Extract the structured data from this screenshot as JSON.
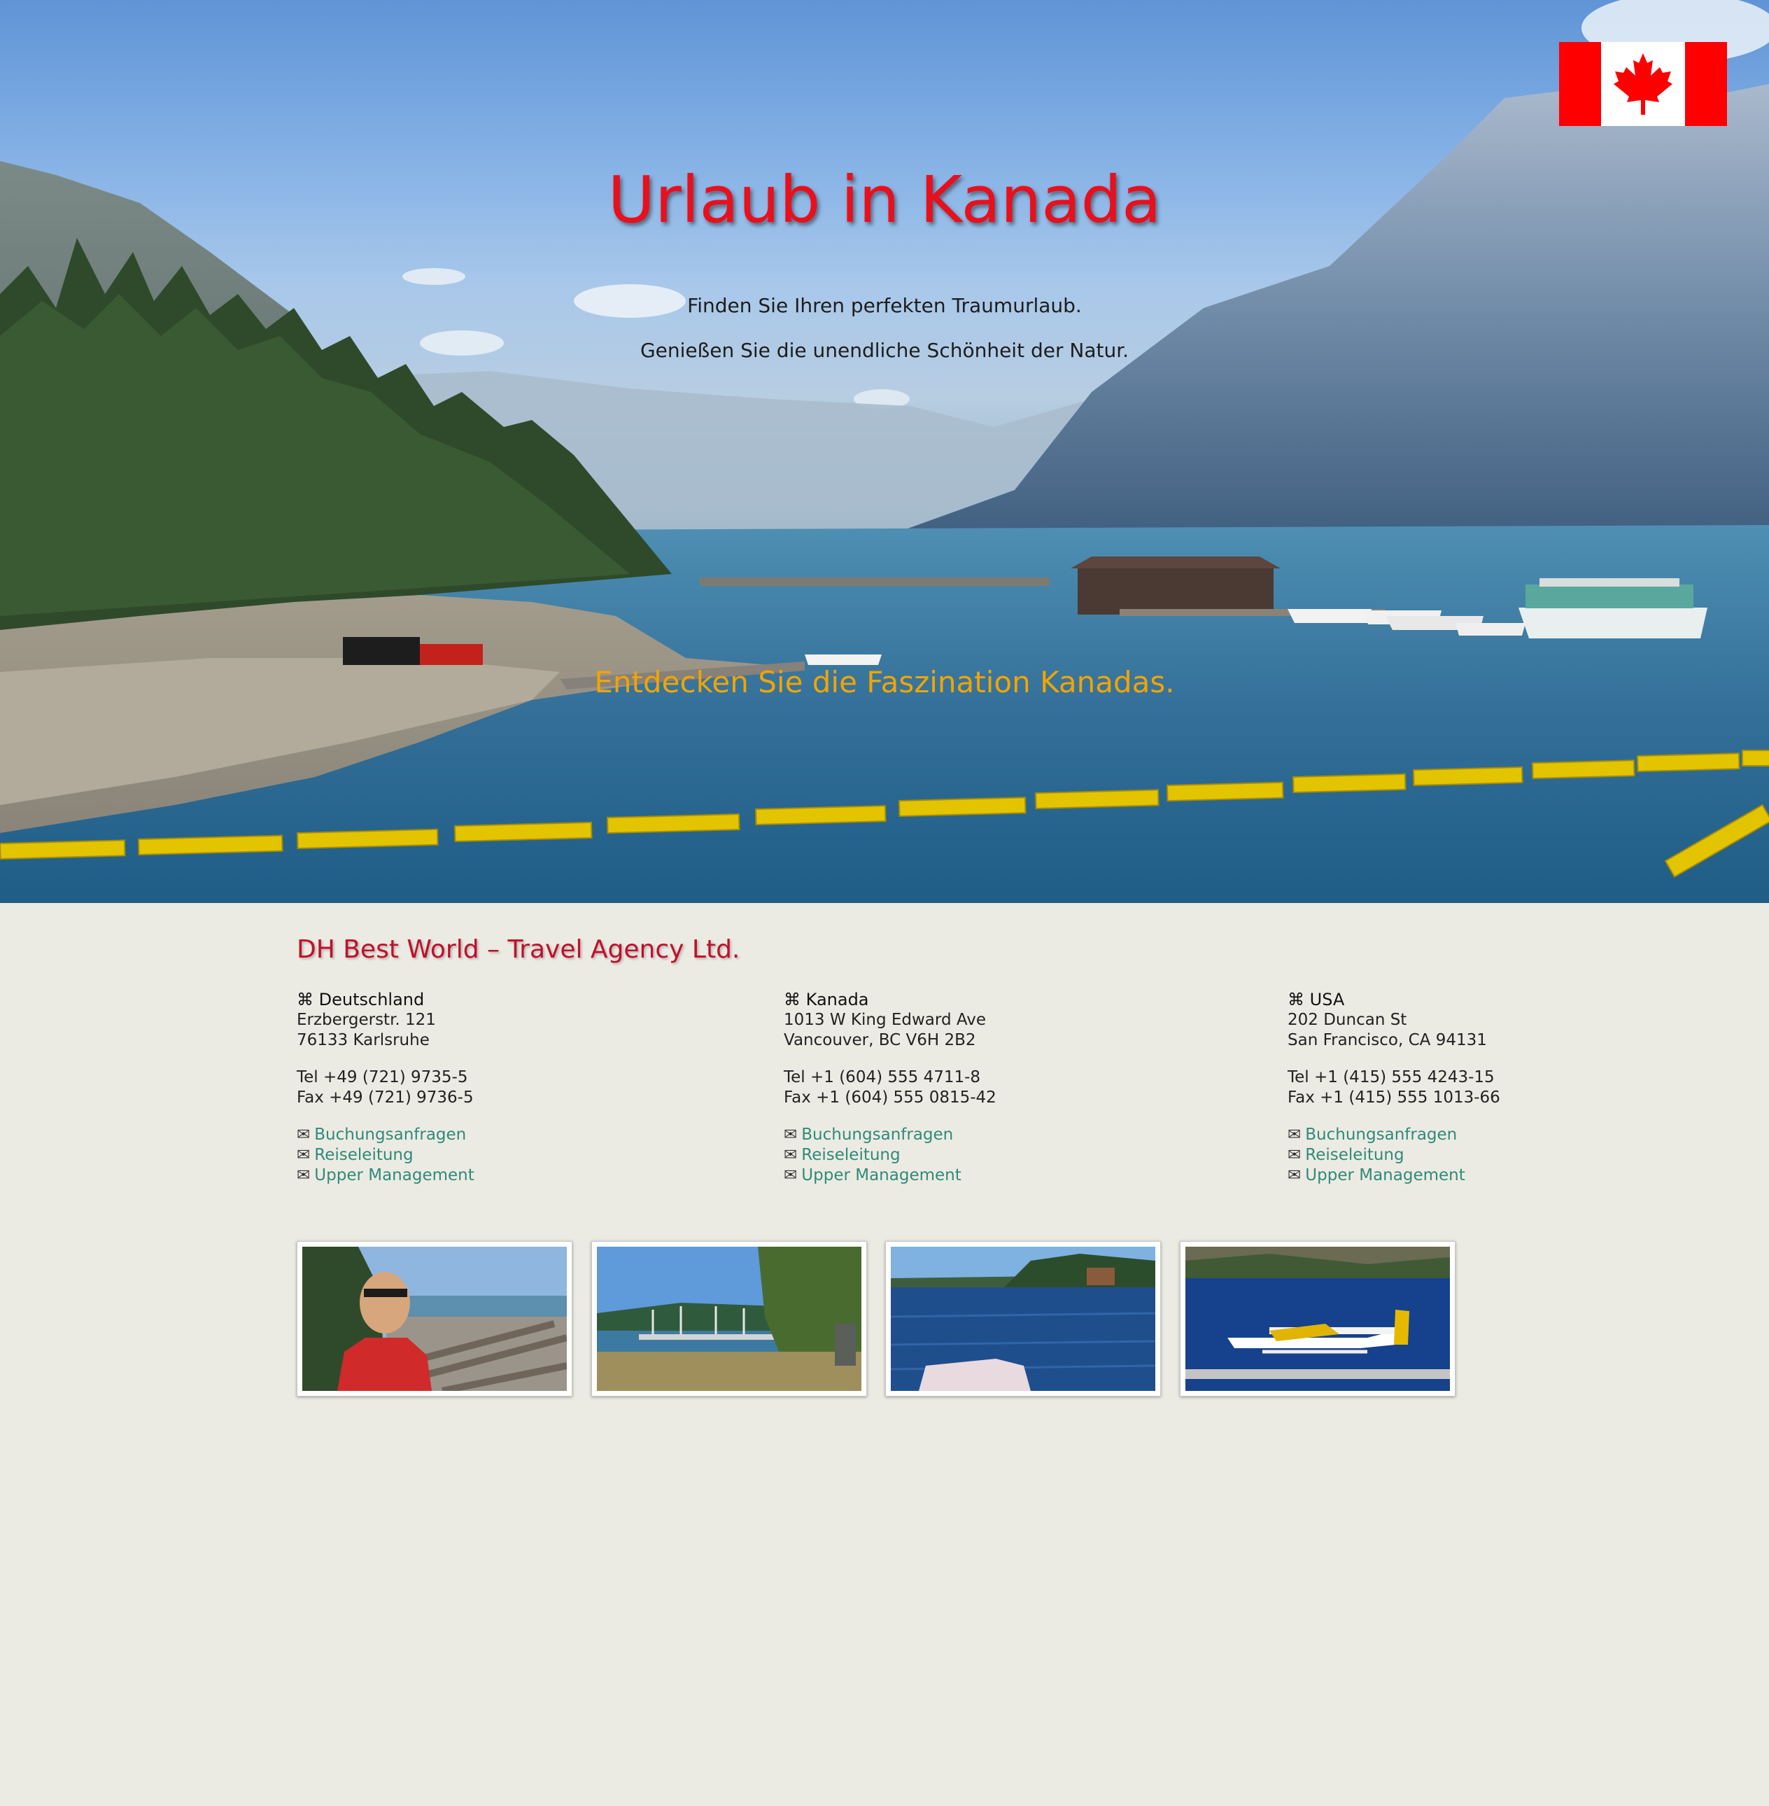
{
  "hero": {
    "title": "Urlaub in Kanada",
    "subtitle_1": "Finden Sie Ihren perfekten Traumurlaub.",
    "subtitle_2": "Genießen Sie die unendliche Schönheit der Natur.",
    "tagline": "Entdecken Sie die Faszination Kanadas.",
    "flag_icon": "canada-flag-icon",
    "colors": {
      "title": "#e8101c",
      "tagline": "#f2a400",
      "flag_red": "#ff0000"
    }
  },
  "company": {
    "name": "DH Best World – Travel Agency Ltd.",
    "color": "#c0102c"
  },
  "offices": [
    {
      "country": "⌘ Deutschland",
      "street": "Erzbergerstr. 121",
      "city": "76133 Karlsruhe",
      "tel": "Tel +49 (721) 9735-5",
      "fax": "Fax +49 (721) 9736-5",
      "links": [
        "Buchungsanfragen",
        "Reiseleitung",
        "Upper Management"
      ]
    },
    {
      "country": "⌘ Kanada",
      "street": "1013 W King Edward Ave",
      "city": "Vancouver, BC V6H 2B2",
      "tel": "Tel +1 (604) 555 4711-8",
      "fax": "Fax +1 (604) 555 0815-42",
      "links": [
        "Buchungsanfragen",
        "Reiseleitung",
        "Upper Management"
      ]
    },
    {
      "country": "⌘ USA",
      "street": "202 Duncan St",
      "city": "San Francisco, CA 94131",
      "tel": "Tel +1 (415) 555 4243-15",
      "fax": "Fax +1 (415) 555 1013-66",
      "links": [
        "Buchungsanfragen",
        "Reiseleitung",
        "Upper Management"
      ]
    }
  ],
  "mail_icon": "✉",
  "link_color": "#2f8a7a",
  "gallery": [
    {
      "name": "gallery-photo-beach-selfie"
    },
    {
      "name": "gallery-photo-marina"
    },
    {
      "name": "gallery-photo-lake-boat"
    },
    {
      "name": "gallery-photo-seaplane"
    }
  ]
}
